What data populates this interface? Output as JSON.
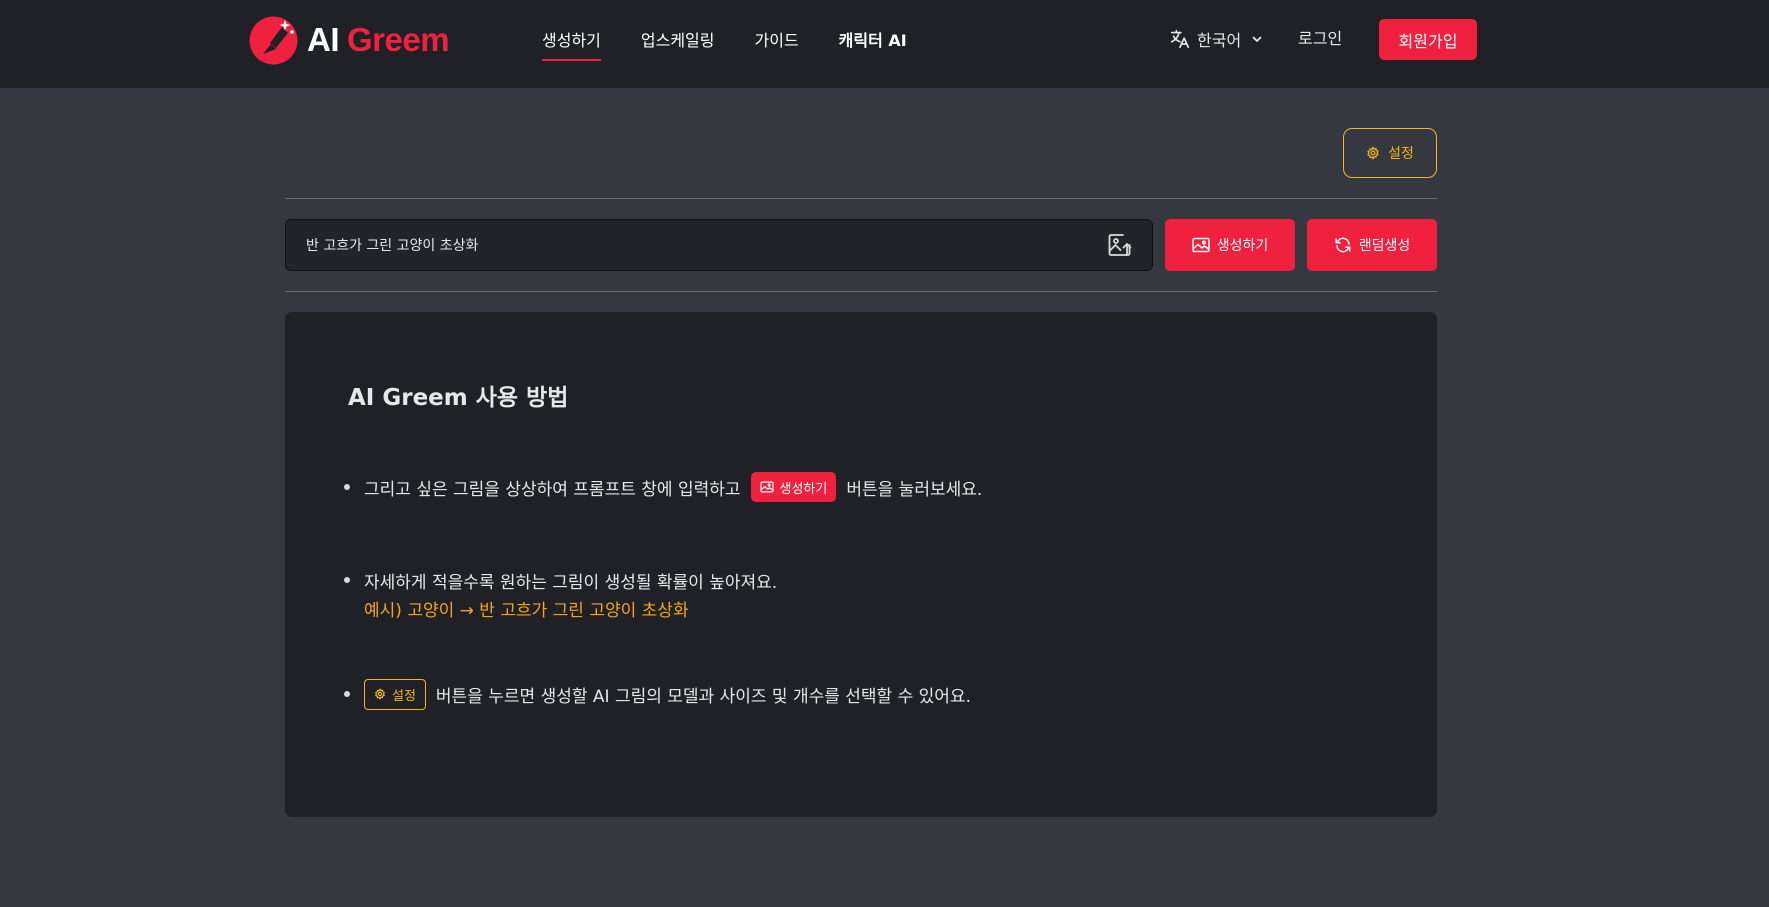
{
  "logo": {
    "ai": "AI",
    "greem": "Greem"
  },
  "nav": {
    "items": [
      {
        "label": "생성하기"
      },
      {
        "label": "업스케일링"
      },
      {
        "label": "가이드"
      },
      {
        "label": "캐릭터 AI"
      }
    ],
    "active": "생성하기"
  },
  "header": {
    "language": "한국어",
    "login": "로그인",
    "signup": "회원가입"
  },
  "toolbar": {
    "settings_label": "설정"
  },
  "prompt": {
    "value": "반 고흐가 그린 고양이 초상화",
    "generate_label": "생성하기",
    "random_label": "랜덤생성"
  },
  "guide": {
    "title": "AI Greem 사용 방법",
    "step1_before": "그리고 싶은 그림을 상상하여 프롬프트 창에 입력하고",
    "step1_button": "생성하기",
    "step1_after": "버튼을 눌러보세요.",
    "step2": "자세하게 적을수록 원하는 그림이 생성될 확률이 높아져요.",
    "step2_example": "예시) 고양이 → 반 고흐가 그린 고양이 초상화",
    "step3_button": "설정",
    "step3_after": "버튼을 누르면 생성할 AI 그림의 모델과 사이즈 및 개수를 선택할 수 있어요."
  },
  "colors": {
    "accent": "#f0213f",
    "settings": "#f3b51c",
    "example": "#f3a51c",
    "header_bg": "#1f2126",
    "page_bg": "#353840"
  }
}
